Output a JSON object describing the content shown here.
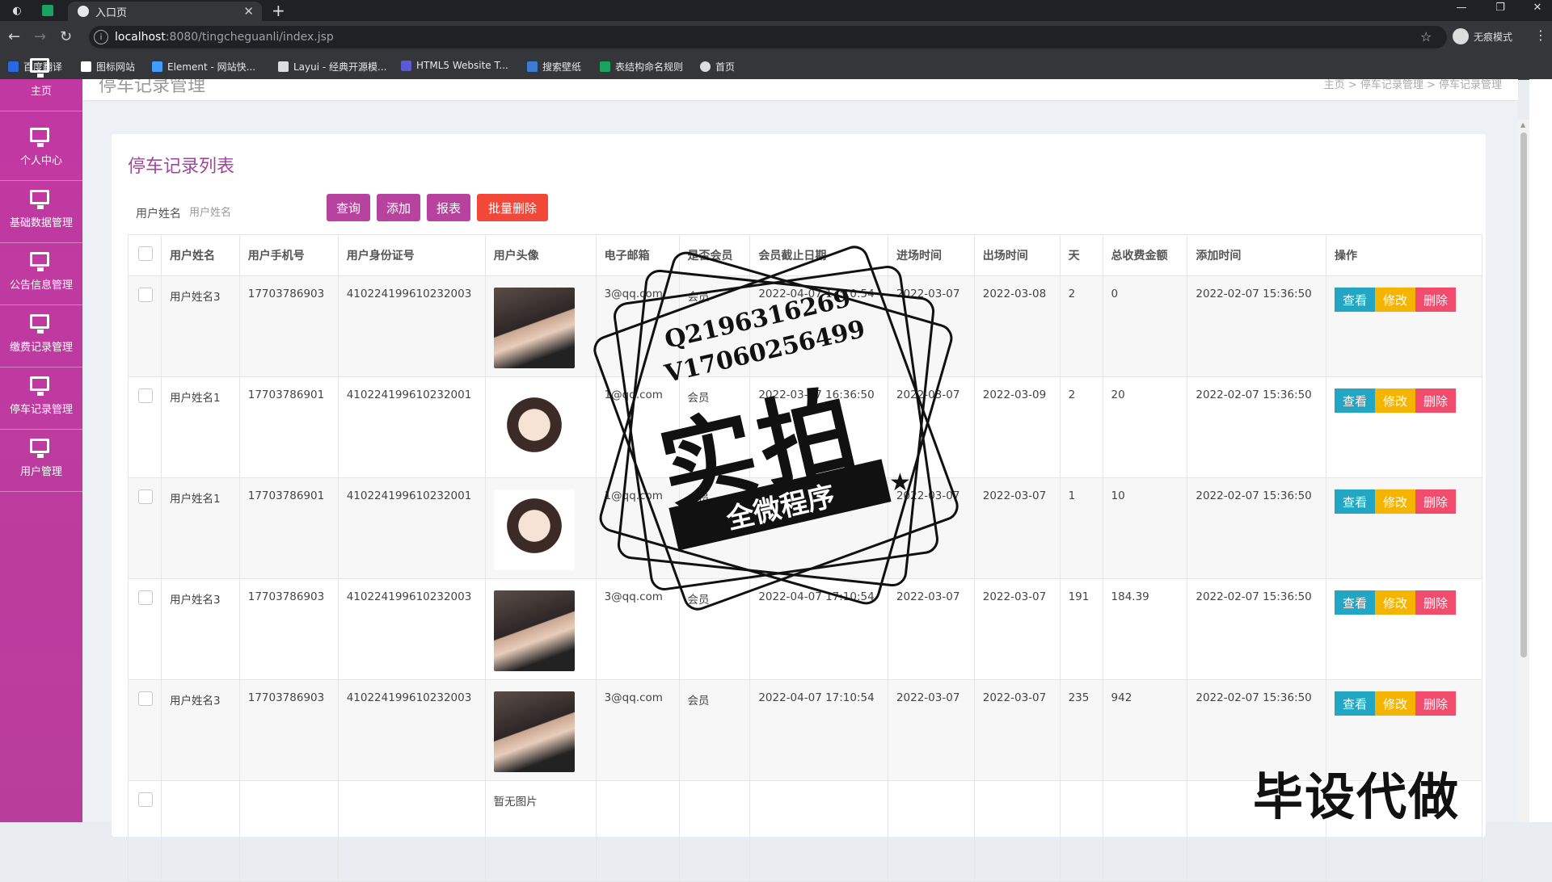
{
  "browser": {
    "tab_title": "入口页",
    "url_host": "localhost",
    "url_path": ":8080/tingcheguanli/index.jsp",
    "incognito_label": "无痕模式",
    "bookmarks": [
      {
        "label": "百度翻译",
        "color": "#2b68e0"
      },
      {
        "label": "图标网站",
        "color": "#ffffff"
      },
      {
        "label": "Element - 网站快...",
        "color": "#409eff"
      },
      {
        "label": "Layui - 经典开源模...",
        "color": "#dddddd"
      },
      {
        "label": "HTML5 Website T...",
        "color": "#5a5ad6"
      },
      {
        "label": "搜索壁纸",
        "color": "#3a7bd5"
      },
      {
        "label": "表结构命名规则",
        "color": "#1aa260"
      },
      {
        "label": "首页",
        "color": "#dddddd"
      }
    ]
  },
  "sidebar": {
    "items": [
      {
        "label": "主页"
      },
      {
        "label": "个人中心"
      },
      {
        "label": "基础数据管理"
      },
      {
        "label": "公告信息管理"
      },
      {
        "label": "缴费记录管理"
      },
      {
        "label": "停车记录管理"
      },
      {
        "label": "用户管理"
      }
    ]
  },
  "header": {
    "page_title": "停车记录管理",
    "breadcrumb": "主页 > 停车记录管理 > 停车记录管理"
  },
  "card": {
    "title": "停车记录列表",
    "search_label": "用户姓名",
    "search_placeholder": "用户姓名",
    "buttons": {
      "query": "查询",
      "add": "添加",
      "report": "报表",
      "batch_delete": "批量删除"
    }
  },
  "table": {
    "headers": [
      "用户姓名",
      "用户手机号",
      "用户身份证号",
      "用户头像",
      "电子邮箱",
      "是否会员",
      "会员截止日期",
      "进场时间",
      "出场时间",
      "天",
      "总收费金额",
      "添加时间",
      "操作"
    ],
    "rows": [
      {
        "name": "用户姓名3",
        "phone": "17703786903",
        "idcard": "410224199610232003",
        "avatar": "photo",
        "email": "3@qq.com",
        "member": "会员",
        "member_end": "2022-04-07 17:10:54",
        "in": "2022-03-07",
        "out": "2022-03-08",
        "days": "2",
        "fee": "0",
        "added": "2022-02-07 15:36:50"
      },
      {
        "name": "用户姓名1",
        "phone": "17703786901",
        "idcard": "410224199610232001",
        "avatar": "cartoon",
        "email": "1@qq.com",
        "member": "会员",
        "member_end": "2022-03-07 16:36:50",
        "in": "2022-03-07",
        "out": "2022-03-09",
        "days": "2",
        "fee": "20",
        "added": "2022-02-07 15:36:50"
      },
      {
        "name": "用户姓名1",
        "phone": "17703786901",
        "idcard": "410224199610232001",
        "avatar": "cartoon",
        "email": "1@qq.com",
        "member": "会员",
        "member_end": "2022-03-07",
        "in": "2022-03-07",
        "out": "2022-03-07",
        "days": "1",
        "fee": "10",
        "added": "2022-02-07 15:36:50"
      },
      {
        "name": "用户姓名3",
        "phone": "17703786903",
        "idcard": "410224199610232003",
        "avatar": "photo",
        "email": "3@qq.com",
        "member": "会员",
        "member_end": "2022-04-07 17:10:54",
        "in": "2022-03-07",
        "out": "2022-03-07",
        "days": "191",
        "fee": "184.39",
        "added": "2022-02-07 15:36:50"
      },
      {
        "name": "用户姓名3",
        "phone": "17703786903",
        "idcard": "410224199610232003",
        "avatar": "photo",
        "email": "3@qq.com",
        "member": "会员",
        "member_end": "2022-04-07 17:10:54",
        "in": "2022-03-07",
        "out": "2022-03-07",
        "days": "235",
        "fee": "942",
        "added": "2022-02-07 15:36:50"
      },
      {
        "name": "",
        "phone": "",
        "idcard": "",
        "avatar": "none",
        "avatar_text": "暂无图片",
        "email": "",
        "member": "",
        "member_end": "",
        "in": "",
        "out": "",
        "days": "",
        "fee": "",
        "added": ""
      }
    ],
    "ops": {
      "view": "查看",
      "edit": "修改",
      "delete": "删除"
    }
  },
  "watermark": {
    "line1": "Q2196316269",
    "line2": "V17060256499",
    "big": "实拍",
    "ribbon": "全微程序",
    "corner": "毕设代做"
  }
}
